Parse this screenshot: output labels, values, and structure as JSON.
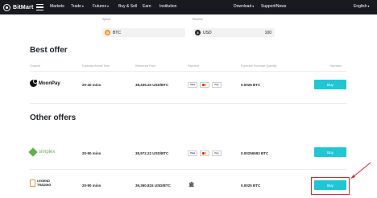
{
  "nav": {
    "brand": "BitMart",
    "links": [
      "Markets",
      "Trade",
      "Futures",
      "Buy & Sell",
      "Earn",
      "Institution"
    ],
    "right": [
      "Download",
      "Support/News",
      "English"
    ]
  },
  "form": {
    "spend_label": "Spend",
    "spend_currency": "BTC",
    "receive_label": "Receive",
    "receive_currency": "USD",
    "receive_amount": "100"
  },
  "best_offer": {
    "title": "Best offer",
    "columns": [
      "Channel",
      "Expected Arrival Time",
      "Reference Price",
      "Payment",
      "Expected Purchase Quantity",
      "Operation"
    ],
    "row": {
      "channel": "MoonPay",
      "time": "20-40 mins",
      "price": "38,435.20 USD/BTC",
      "quantity": "0.0026 BTC",
      "button": "Buy"
    }
  },
  "other_offers": {
    "title": "Other offers",
    "rows": [
      {
        "channel": "simplex",
        "time": "20-90 mins",
        "price": "38,972.22 USD/BTC",
        "quantity": "0.00256593 BTC",
        "button": "Buy"
      },
      {
        "channel": "LEGEND TRADING",
        "time": "20-90 mins",
        "price": "39,360.815 USD/BTC",
        "quantity": "0.0025 BTC",
        "button": "Buy"
      }
    ]
  },
  "payment_icons": [
    "Visa",
    "Mastercard",
    "Apple Pay"
  ],
  "colors": {
    "topbar": "#181a20",
    "buy": "#1fc7d4",
    "highlight": "#e0252b"
  }
}
